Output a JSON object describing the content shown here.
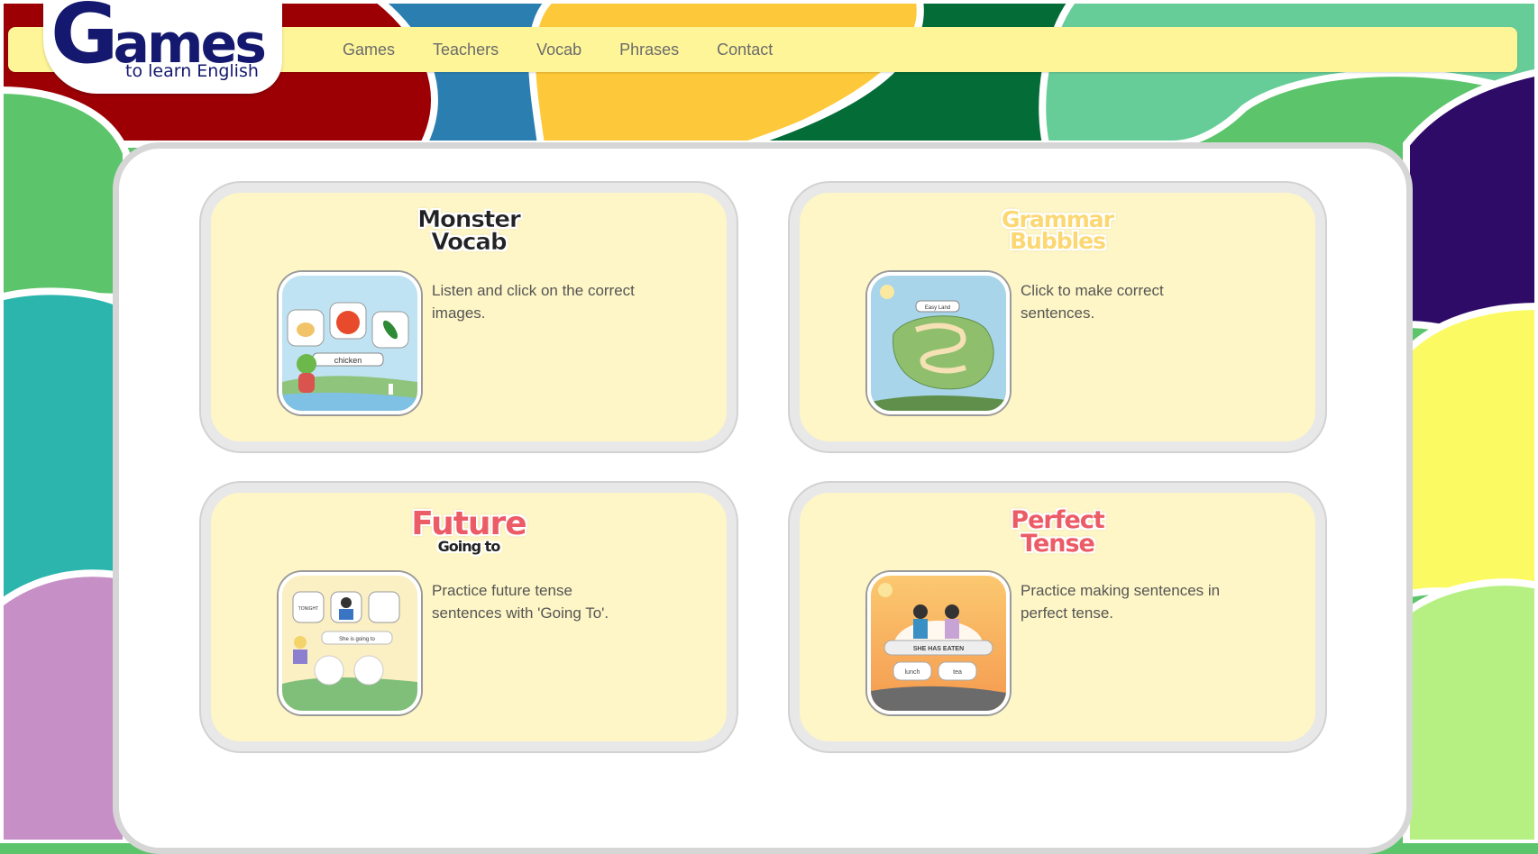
{
  "site": {
    "logo_main": "Games",
    "logo_sub": "to learn English"
  },
  "nav": {
    "items": [
      "Games",
      "Teachers",
      "Vocab",
      "Phrases",
      "Contact"
    ]
  },
  "games": [
    {
      "title_lines": [
        "Monster",
        "Vocab"
      ],
      "description": "Listen and click on the correct images.",
      "thumb_label": "chicken"
    },
    {
      "title_lines": [
        "Grammar",
        "Bubbles"
      ],
      "description": "Click to make correct sentences.",
      "thumb_label": "Easy Land"
    },
    {
      "title_lines": [
        "Future",
        "Going to"
      ],
      "description": "Practice future tense sentences with 'Going To'.",
      "thumb_labels": [
        "TONIGHT",
        "She is going to"
      ]
    },
    {
      "title_lines": [
        "Perfect",
        "Tense"
      ],
      "description": "Practice making sentences in perfect tense.",
      "thumb_labels": [
        "SHE HAS EATEN",
        "lunch",
        "tea"
      ]
    }
  ],
  "colors": {
    "nav_bg": "#fef599",
    "card_bg": "#fef6c6",
    "logo_text": "#14186e",
    "nav_text": "#6b6b6b"
  }
}
